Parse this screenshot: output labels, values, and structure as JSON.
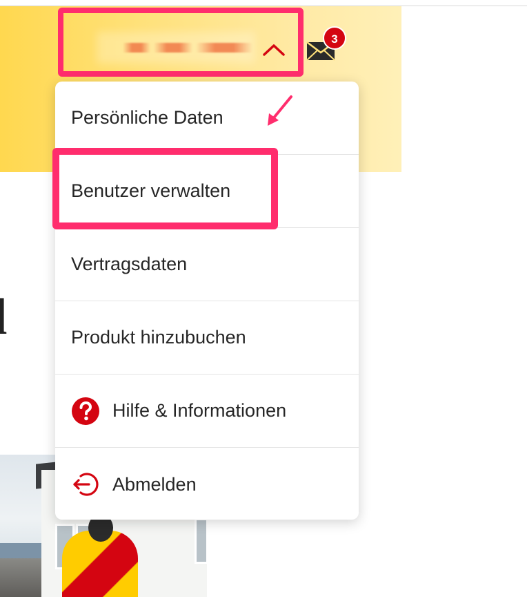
{
  "header": {
    "user_name": "██████ ████",
    "notifications_count": "3"
  },
  "page": {
    "headline_fragment": "l"
  },
  "menu": {
    "items": [
      {
        "label": "Persönliche Daten"
      },
      {
        "label": "Benutzer verwalten"
      },
      {
        "label": "Vertragsdaten"
      },
      {
        "label": "Produkt hinzubuchen"
      },
      {
        "label": "Hilfe & Informationen",
        "icon": "question-circle-icon"
      },
      {
        "label": "Abmelden",
        "icon": "logout-icon"
      }
    ]
  },
  "colors": {
    "brand_yellow": "#ffcc00",
    "brand_red": "#d40511",
    "annotation_pink": "#ff2d6d"
  }
}
